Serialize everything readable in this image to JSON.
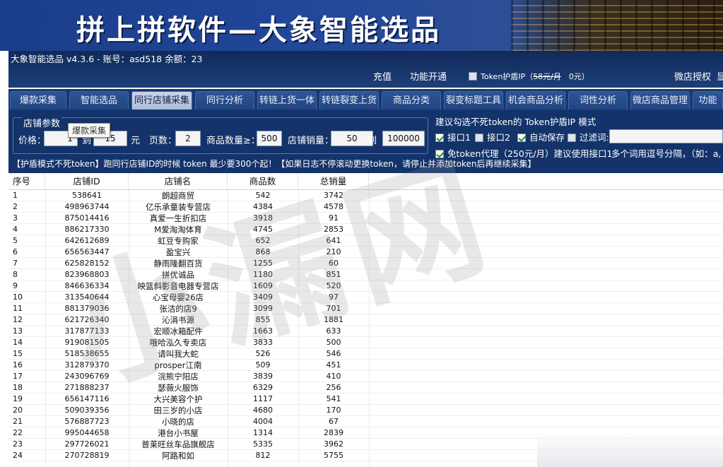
{
  "banner": {
    "title": "拼上拼软件—大象智能选品"
  },
  "window": {
    "title": "大象智能选品 v4.3.6 - 账号：asd518 余额：23"
  },
  "header": {
    "recharge": "充值",
    "activate": "功能开通",
    "token_ip_label": "Token护盾IP",
    "token_ip_price": "58元/月",
    "token_ip_now": "0元）",
    "wechat_auth": "微店授权",
    "cut_char": "显"
  },
  "tabs": [
    {
      "label": "爆款采集"
    },
    {
      "label": "智能选品"
    },
    {
      "label": "同行店铺采集"
    },
    {
      "label": "同行分析"
    },
    {
      "label": "转链上货一体"
    },
    {
      "label": "转链裂变上货"
    },
    {
      "label": "商品分类"
    },
    {
      "label": "裂变标题工具"
    },
    {
      "label": "机会商品分析"
    },
    {
      "label": "词性分析"
    },
    {
      "label": "微店商品管理"
    },
    {
      "label": "功能"
    }
  ],
  "panel": {
    "legend": "店铺参数",
    "price_label": "价格：",
    "price_min": "1",
    "to1": "到",
    "price_max": "15",
    "yuan": "元",
    "pages_label": "页数：",
    "pages": "2",
    "count_label": "商品数量≥：",
    "count": "500",
    "sales_label": "店铺销量：",
    "sales_min": "50",
    "to2": "到",
    "sales_max": "100000",
    "tooltip": "爆款采集",
    "note": "建议勾选不死token的  Token护盾IP 模式",
    "opt_api1": "接口1",
    "opt_api2": "接口2",
    "opt_autosave": "自动保存",
    "opt_filter": "过滤词:",
    "opt_free_token": "免token代理（250元/月）建议使用接口1",
    "separator_hint": "多个词用逗号分隔，（如：a,",
    "warning": "【护盾模式不死token】跑同行店铺ID的时候 token 最少要300个起！【如果日志不停滚动更换token，请停止并添加token后再继续采集】"
  },
  "table": {
    "columns": [
      "序号",
      "店铺ID",
      "店铺名",
      "商品数",
      "总销量"
    ],
    "rows": [
      [
        "1",
        "538641",
        "朗超商贸",
        "542",
        "3742"
      ],
      [
        "2",
        "498963744",
        "亿乐承童装专营店",
        "4384",
        "4578"
      ],
      [
        "3",
        "875014416",
        "真爱一生折扣店",
        "3918",
        "91"
      ],
      [
        "4",
        "886217330",
        "M爱淘淘体育",
        "4745",
        "2853"
      ],
      [
        "5",
        "642612689",
        "虹豆专购家",
        "652",
        "641"
      ],
      [
        "6",
        "656563447",
        "盈宝兴",
        "868",
        "210"
      ],
      [
        "7",
        "625828152",
        "静雨隆翻百货",
        "1255",
        "60"
      ],
      [
        "8",
        "823968803",
        "拼优诚品",
        "1180",
        "851"
      ],
      [
        "9",
        "846636334",
        "映篮斜影音电器专营店",
        "1609",
        "520"
      ],
      [
        "10",
        "313540644",
        "心宝母婴26店",
        "3409",
        "97"
      ],
      [
        "11",
        "881379036",
        "张洁的店9",
        "3099",
        "701"
      ],
      [
        "12",
        "621726340",
        "沁涓书源",
        "855",
        "1881"
      ],
      [
        "13",
        "317877133",
        "宏顺冰箱配件",
        "1663",
        "633"
      ],
      [
        "14",
        "919081505",
        "哦哈泓久专卖店",
        "3833",
        "500"
      ],
      [
        "15",
        "518538655",
        "请叫我大蛇",
        "526",
        "546"
      ],
      [
        "16",
        "312879370",
        "prosper江南",
        "509",
        "451"
      ],
      [
        "17",
        "243096769",
        "浣熊宁阳店",
        "3839",
        "410"
      ],
      [
        "18",
        "271888237",
        "瑟薇火服饰",
        "6329",
        "256"
      ],
      [
        "19",
        "656147116",
        "大兴美容个护",
        "1117",
        "541"
      ],
      [
        "20",
        "509039356",
        "田三岁的小店",
        "4680",
        "170"
      ],
      [
        "21",
        "576887723",
        "小晓的店",
        "4004",
        "67"
      ],
      [
        "22",
        "995044658",
        "港台小书屋",
        "1314",
        "2839"
      ],
      [
        "23",
        "297726021",
        "普莱旺丝车品旗舰店",
        "5335",
        "3962"
      ],
      [
        "24",
        "270728819",
        "阿路和如",
        "812",
        "5755"
      ]
    ]
  }
}
